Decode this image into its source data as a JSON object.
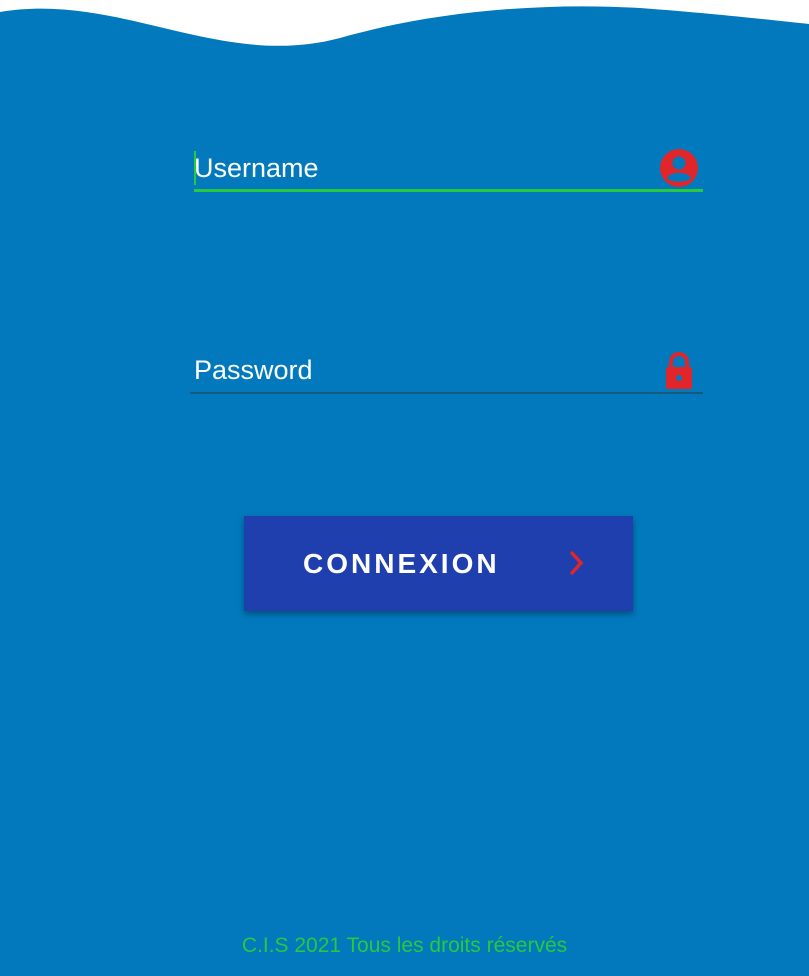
{
  "theme": {
    "background": "#0279bd",
    "accent_green": "#27c93f",
    "icon_red": "#e0262b",
    "button_bg": "#1f3faf"
  },
  "form": {
    "username": {
      "placeholder": "Username",
      "value": "",
      "icon": "account-circle-icon"
    },
    "password": {
      "placeholder": "Password",
      "value": "",
      "icon": "lock-icon"
    },
    "submit": {
      "label": "CONNEXION",
      "icon": "chevron-right-icon"
    }
  },
  "footer": {
    "text": "C.I.S 2021 Tous les droits réservés"
  }
}
